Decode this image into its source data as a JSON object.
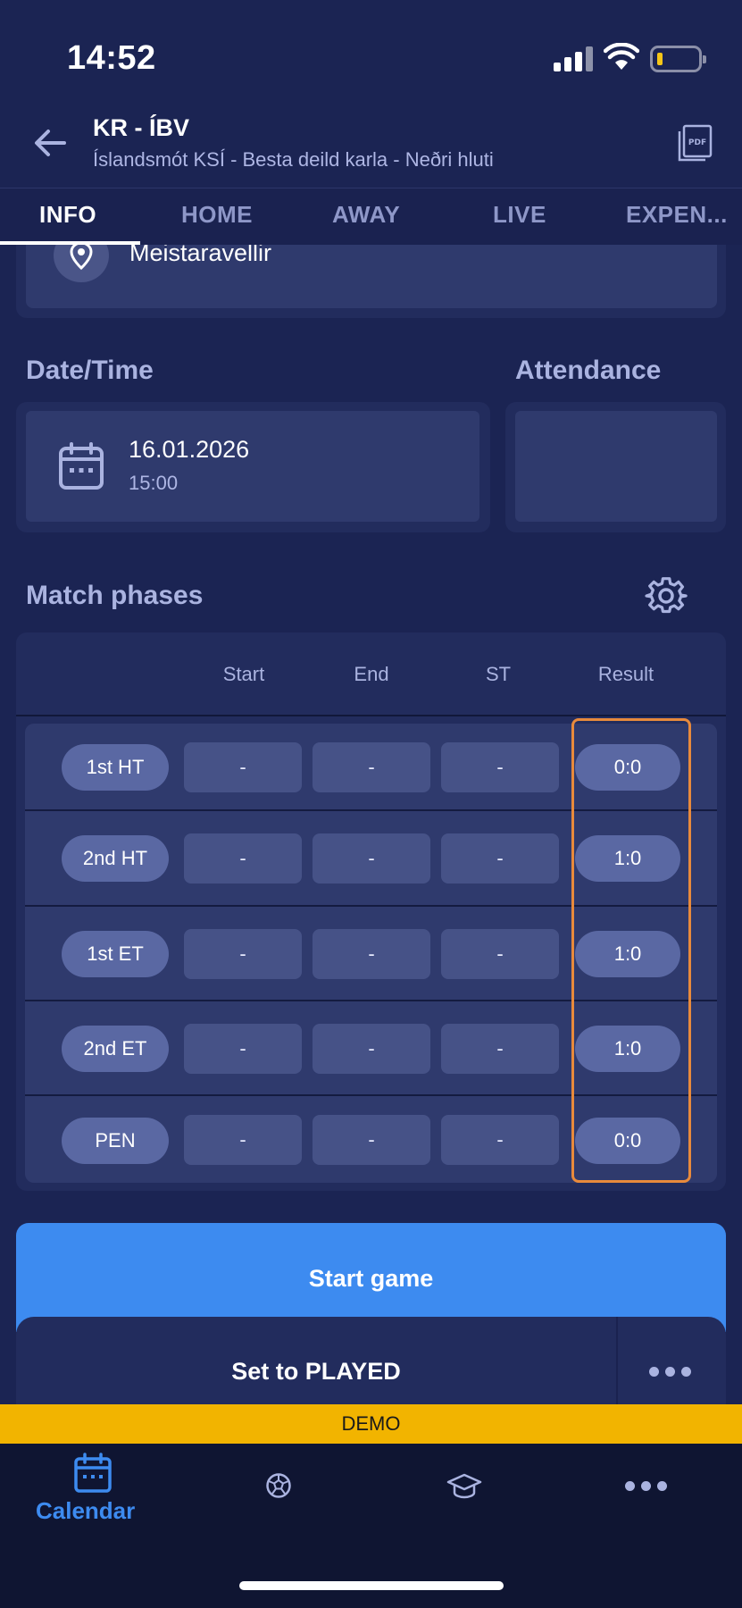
{
  "status_bar": {
    "time": "14:52"
  },
  "header": {
    "title": "KR - ÍBV",
    "subtitle": "Íslandsmót KSÍ - Besta deild karla - Neðri hluti"
  },
  "tabs": [
    {
      "label": "INFO",
      "active": true
    },
    {
      "label": "HOME"
    },
    {
      "label": "AWAY"
    },
    {
      "label": "LIVE"
    },
    {
      "label": "EXPEN..."
    }
  ],
  "venue": {
    "name": "Meistaravellir"
  },
  "datetime": {
    "heading": "Date/Time",
    "date": "16.01.2026",
    "time": "15:00"
  },
  "attendance": {
    "heading": "Attendance",
    "value": ""
  },
  "match_phases": {
    "heading": "Match phases",
    "columns": [
      "Start",
      "End",
      "ST",
      "Result"
    ],
    "rows": [
      {
        "phase": "1st HT",
        "start": "-",
        "end": "-",
        "st": "-",
        "result": "0:0"
      },
      {
        "phase": "2nd HT",
        "start": "-",
        "end": "-",
        "st": "-",
        "result": "1:0"
      },
      {
        "phase": "1st ET",
        "start": "-",
        "end": "-",
        "st": "-",
        "result": "1:0"
      },
      {
        "phase": "2nd ET",
        "start": "-",
        "end": "-",
        "st": "-",
        "result": "1:0"
      },
      {
        "phase": "PEN",
        "start": "-",
        "end": "-",
        "st": "-",
        "result": "0:0"
      }
    ]
  },
  "actions": {
    "start_game": "Start game",
    "set_played": "Set to PLAYED"
  },
  "demo_banner": "DEMO",
  "bottom_nav": {
    "items": [
      {
        "label": "Calendar",
        "icon": "calendar-icon",
        "active": true
      },
      {
        "label": "",
        "icon": "soccer-ball-icon"
      },
      {
        "label": "",
        "icon": "graduation-cap-icon"
      },
      {
        "label": "",
        "icon": "more-dots-icon"
      }
    ]
  },
  "colors": {
    "background": "#1b2453",
    "accent": "#3d8bf0",
    "highlight": "#e88a3c",
    "demo": "#f2b400"
  }
}
